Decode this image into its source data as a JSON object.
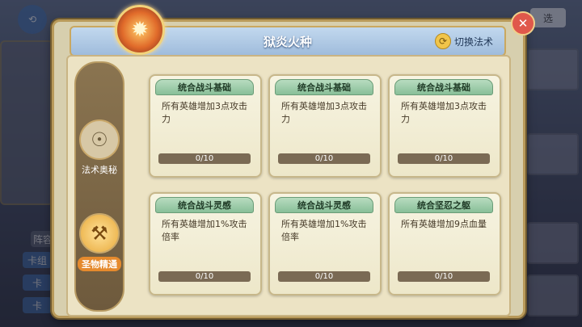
{
  "dialog": {
    "title": "狱炎火种",
    "switch_label": "切换法术",
    "close_glyph": "✕"
  },
  "sidenav": {
    "items": [
      {
        "label": "法术奥秘",
        "active": false
      },
      {
        "label": "圣物精通",
        "active": true
      }
    ]
  },
  "cards": [
    {
      "name": "统合战斗基础",
      "desc": "所有英雄增加3点攻击力",
      "progress": "0/10",
      "fill": 0
    },
    {
      "name": "统合战斗基础",
      "desc": "所有英雄增加3点攻击力",
      "progress": "0/10",
      "fill": 0
    },
    {
      "name": "统合战斗基础",
      "desc": "所有英雄增加3点攻击力",
      "progress": "0/10",
      "fill": 0
    },
    {
      "name": "统合战斗灵感",
      "desc": "所有英雄增加1%攻击倍率",
      "progress": "0/10",
      "fill": 0
    },
    {
      "name": "统合战斗灵感",
      "desc": "所有英雄增加1%攻击倍率",
      "progress": "0/10",
      "fill": 0
    },
    {
      "name": "统合坚忍之躯",
      "desc": "所有英雄增加9点血量",
      "progress": "0/10",
      "fill": 0
    }
  ],
  "background": {
    "left_labels": [
      "阵容",
      "卡组",
      "卡",
      "卡"
    ],
    "right_labels": [
      "选"
    ]
  },
  "colors": {
    "accent": "#e58a2d",
    "title_bar": "#9fbcdc",
    "card_head": "#88bf98"
  }
}
